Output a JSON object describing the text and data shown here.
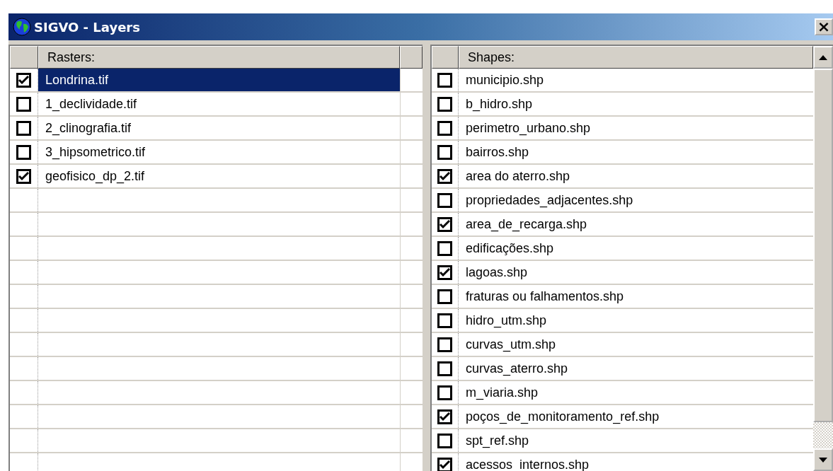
{
  "window": {
    "title": "SIGVO - Layers",
    "close": "×"
  },
  "rasters": {
    "heading": "Rasters:",
    "items": [
      {
        "name": "Londrina.tif",
        "checked": true,
        "selected": true
      },
      {
        "name": "1_declividade.tif",
        "checked": false,
        "selected": false
      },
      {
        "name": "2_clinografia.tif",
        "checked": false,
        "selected": false
      },
      {
        "name": "3_hipsometrico.tif",
        "checked": false,
        "selected": false
      },
      {
        "name": "geofisico_dp_2.tif",
        "checked": true,
        "selected": false
      }
    ]
  },
  "shapes": {
    "heading": "Shapes:",
    "items": [
      {
        "name": "municipio.shp",
        "checked": false
      },
      {
        "name": "b_hidro.shp",
        "checked": false
      },
      {
        "name": "perimetro_urbano.shp",
        "checked": false
      },
      {
        "name": "bairros.shp",
        "checked": false
      },
      {
        "name": "area do aterro.shp",
        "checked": true
      },
      {
        "name": "propriedades_adjacentes.shp",
        "checked": false
      },
      {
        "name": "area_de_recarga.shp",
        "checked": true
      },
      {
        "name": "edificações.shp",
        "checked": false
      },
      {
        "name": "lagoas.shp",
        "checked": true
      },
      {
        "name": "fraturas ou falhamentos.shp",
        "checked": false
      },
      {
        "name": "hidro_utm.shp",
        "checked": false
      },
      {
        "name": "curvas_utm.shp",
        "checked": false
      },
      {
        "name": "curvas_aterro.shp",
        "checked": false
      },
      {
        "name": "m_viaria.shp",
        "checked": false
      },
      {
        "name": "poços_de_monitoramento_ref.shp",
        "checked": true
      },
      {
        "name": "spt_ref.shp",
        "checked": false
      },
      {
        "name": "acessos_internos.shp",
        "checked": true
      }
    ]
  }
}
